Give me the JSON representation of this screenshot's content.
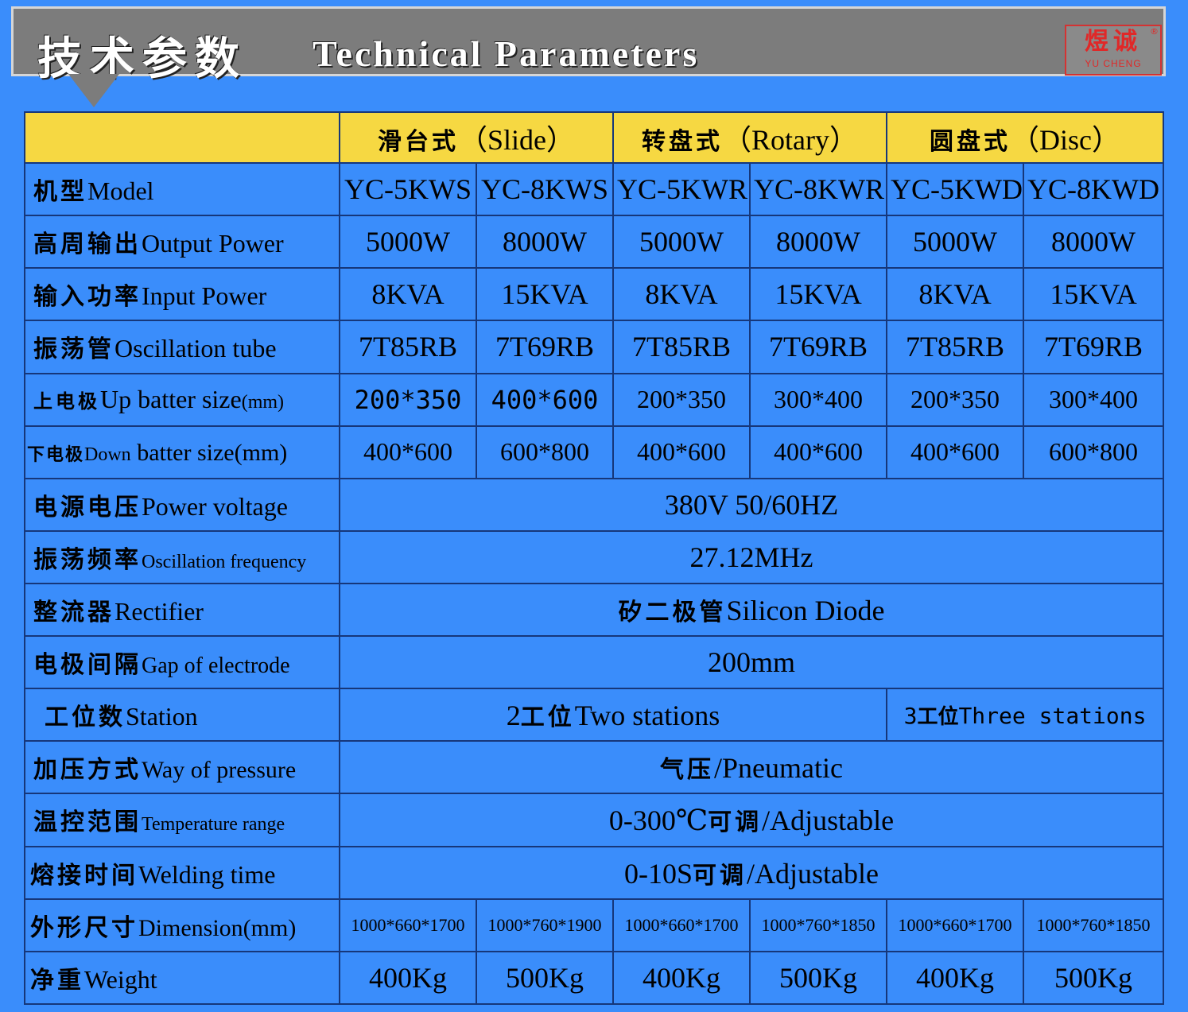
{
  "header": {
    "title_cn": "技术参数",
    "title_en": "Technical Parameters",
    "logo_cn": "煜诚",
    "logo_en": "YU CHENG",
    "logo_mark": "®"
  },
  "columns": [
    {
      "cn": "滑台式",
      "en": "（Slide）"
    },
    {
      "cn": "转盘式",
      "en": "（Rotary）"
    },
    {
      "cn": "圆盘式",
      "en": "（Disc）"
    }
  ],
  "rows": {
    "model": {
      "cn": "机型",
      "en": "Model",
      "values": [
        "YC-5KWS",
        "YC-8KWS",
        "YC-5KWR",
        "YC-8KWR",
        "YC-5KWD",
        "YC-8KWD"
      ]
    },
    "output_power": {
      "cn": "高周输出",
      "en": "Output Power",
      "values": [
        "5000W",
        "8000W",
        "5000W",
        "8000W",
        "5000W",
        "8000W"
      ]
    },
    "input_power": {
      "cn": "输入功率",
      "en": "Input Power",
      "values": [
        "8KVA",
        "15KVA",
        "8KVA",
        "15KVA",
        "8KVA",
        "15KVA"
      ]
    },
    "oscillation_tube": {
      "cn": "振荡管",
      "en": "Oscillation tube",
      "values": [
        "7T85RB",
        "7T69RB",
        "7T85RB",
        "7T69RB",
        "7T85RB",
        "7T69RB"
      ]
    },
    "up_batter": {
      "cn": "上电极",
      "en": "Up batter size",
      "unit": "(mm)",
      "values": [
        "200*350",
        "400*600",
        "200*350",
        "300*400",
        "200*350",
        "300*400"
      ]
    },
    "down_batter": {
      "cn": "下电极",
      "en_small": "Down",
      "en": " batter size(mm)",
      "values": [
        "400*600",
        "600*800",
        "400*600",
        "400*600",
        "400*600",
        "600*800"
      ]
    },
    "power_voltage": {
      "cn": "电源电压",
      "en": "Power voltage",
      "value": "380V 50/60HZ"
    },
    "osc_freq": {
      "cn": "振荡频率",
      "en": "Oscillation frequency",
      "value": "27.12MHz"
    },
    "rectifier": {
      "cn": "整流器",
      "en": "Rectifier",
      "value_cn": "矽二极管",
      "value_en": "Silicon Diode"
    },
    "gap": {
      "cn": "电极间隔",
      "en": "Gap of electrode",
      "value": "200mm"
    },
    "station": {
      "cn": "工位数",
      "en": "Station",
      "value_a_num": "2",
      "value_a_cn": "工位",
      "value_a_en": "Two stations",
      "value_b_num": "3",
      "value_b_cn": "工位",
      "value_b_en": "Three stations"
    },
    "pressure": {
      "cn": "加压方式",
      "en": "Way of pressure",
      "value_cn": "气压",
      "value_en": "/Pneumatic"
    },
    "temperature": {
      "cn": "温控范围",
      "en": "Temperature range",
      "value_a": "0-300℃",
      "value_cn": "可调",
      "value_en": "/Adjustable"
    },
    "welding_time": {
      "cn": "熔接时间",
      "en": "Welding time",
      "value_a": "0-10S",
      "value_cn": "可调",
      "value_en": "/Adjustable"
    },
    "dimension": {
      "cn": "外形尺寸",
      "en": "Dimension(mm)",
      "values": [
        "1000*660*1700",
        "1000*760*1900",
        "1000*660*1700",
        "1000*760*1850",
        "1000*660*1700",
        "1000*760*1850"
      ]
    },
    "weight": {
      "cn": "净重",
      "en": "Weight",
      "values": [
        "400Kg",
        "500Kg",
        "400Kg",
        "500Kg",
        "400Kg",
        "500Kg"
      ]
    }
  }
}
